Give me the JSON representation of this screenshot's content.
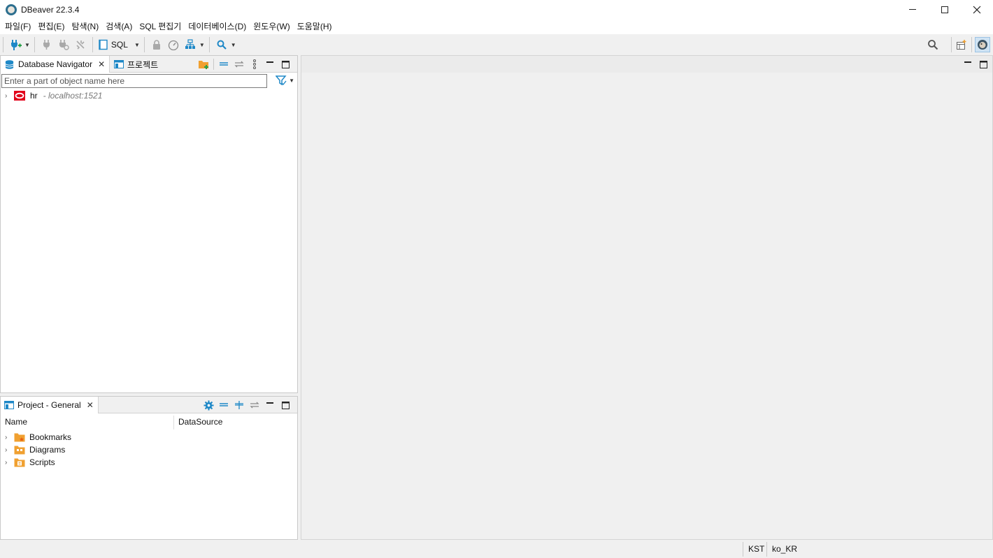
{
  "window": {
    "title": "DBeaver 22.3.4"
  },
  "menu": [
    "파일(F)",
    "편집(E)",
    "탐색(N)",
    "검색(A)",
    "SQL 편집기",
    "데이터베이스(D)",
    "윈도우(W)",
    "도움말(H)"
  ],
  "toolbar": {
    "sql_label": "SQL"
  },
  "navigator": {
    "tab_label": "Database Navigator",
    "projects_tab_label": "프로젝트",
    "filter_placeholder": "Enter a part of object name here",
    "connections": [
      {
        "name": "hr",
        "host": "- localhost:1521"
      }
    ]
  },
  "project_panel": {
    "tab_label": "Project - General",
    "columns": [
      "Name",
      "DataSource"
    ],
    "items": [
      "Bookmarks",
      "Diagrams",
      "Scripts"
    ]
  },
  "status": {
    "timezone": "KST",
    "locale": "ko_KR"
  },
  "colors": {
    "accent_blue": "#1e88c7",
    "oracle_red": "#e2001a",
    "folder_orange": "#f0a030"
  }
}
